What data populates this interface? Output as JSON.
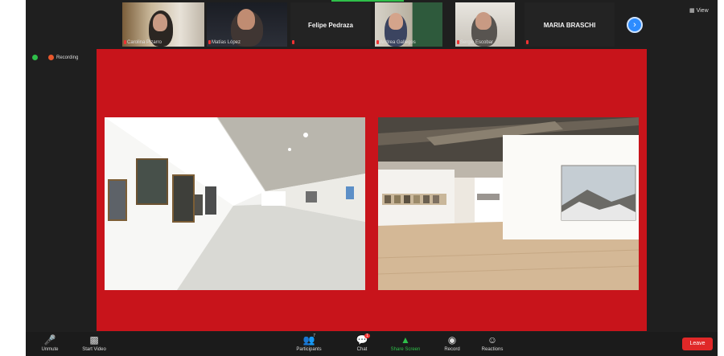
{
  "participants": [
    {
      "name": "Carolina Pizarro",
      "display": "video"
    },
    {
      "name": "Matías López",
      "display": "video"
    },
    {
      "name": "Felipe Pedraza",
      "display": "name"
    },
    {
      "name": "Andrea Gallegos",
      "display": "video"
    },
    {
      "name": "Sergio Escobar",
      "display": "video"
    },
    {
      "name": "MARIA BRASCHI",
      "display": "name"
    }
  ],
  "view_button": "View",
  "status": {
    "recording_label": "Recording",
    "encryption_icon": "shield-icon",
    "colors": {
      "encryption": "#2fbf4a",
      "recording": "#e8572c"
    }
  },
  "share": {
    "background": "#c8141b",
    "images": [
      "gallery-photo-left",
      "gallery-photo-right"
    ]
  },
  "controls": {
    "unmute": "Unmute",
    "start_video": "Start Video",
    "participants": "Participants",
    "participants_count": "7",
    "chat": "Chat",
    "chat_badge": "1",
    "share_screen": "Share Screen",
    "record": "Record",
    "reactions": "Reactions",
    "end": "Leave"
  }
}
